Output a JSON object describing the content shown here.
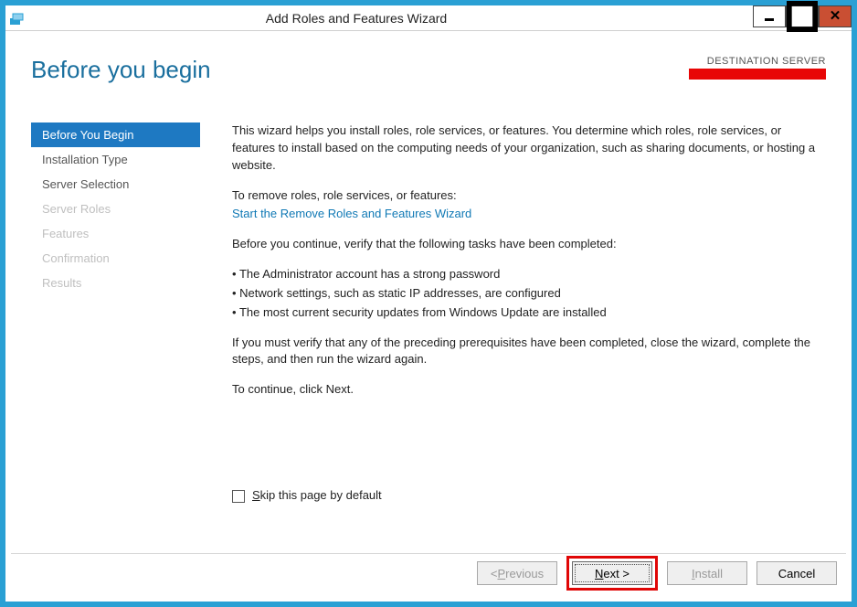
{
  "window": {
    "title": "Add Roles and Features Wizard"
  },
  "header": {
    "heading": "Before you begin",
    "destination_label": "DESTINATION SERVER"
  },
  "nav": {
    "items": [
      {
        "label": "Before You Begin",
        "state": "selected"
      },
      {
        "label": "Installation Type",
        "state": "enabled"
      },
      {
        "label": "Server Selection",
        "state": "enabled"
      },
      {
        "label": "Server Roles",
        "state": "disabled"
      },
      {
        "label": "Features",
        "state": "disabled"
      },
      {
        "label": "Confirmation",
        "state": "disabled"
      },
      {
        "label": "Results",
        "state": "disabled"
      }
    ]
  },
  "body": {
    "intro": "This wizard helps you install roles, role services, or features. You determine which roles, role services, or features to install based on the computing needs of your organization, such as sharing documents, or hosting a website.",
    "remove_lead": "To remove roles, role services, or features:",
    "remove_link": "Start the Remove Roles and Features Wizard",
    "verify_lead": "Before you continue, verify that the following tasks have been completed:",
    "bullets": [
      "The Administrator account has a strong password",
      "Network settings, such as static IP addresses, are configured",
      "The most current security updates from Windows Update are installed"
    ],
    "verify_trail": "If you must verify that any of the preceding prerequisites have been completed, close the wizard, complete the steps, and then run the wizard again.",
    "continue_text": "To continue, click Next."
  },
  "skip": {
    "label_pre": "S",
    "label_post": "kip this page by default",
    "checked": false
  },
  "footer": {
    "previous_pre": "< ",
    "previous_ul": "P",
    "previous_post": "revious",
    "next_ul": "N",
    "next_post": "ext >",
    "install_ul": "I",
    "install_post": "nstall",
    "cancel": "Cancel"
  }
}
